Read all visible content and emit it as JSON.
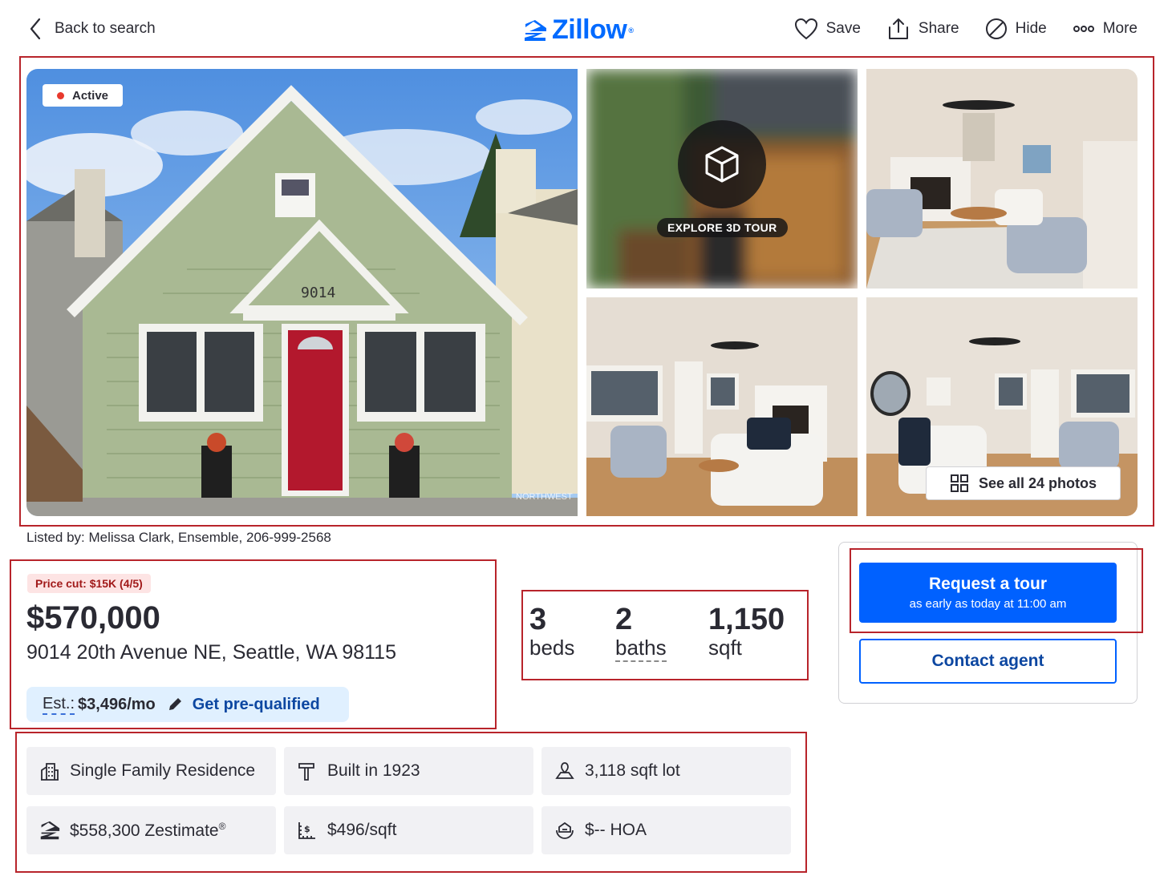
{
  "header": {
    "back_label": "Back to search",
    "logo_text": "Zillow",
    "logo_mark": "®",
    "actions": [
      {
        "label": "Save",
        "icon": "heart-icon"
      },
      {
        "label": "Share",
        "icon": "share-icon"
      },
      {
        "label": "Hide",
        "icon": "hide-icon"
      },
      {
        "label": "More",
        "icon": "more-icon"
      }
    ]
  },
  "gallery": {
    "status_badge": "Active",
    "house_number": "9014",
    "watermark": "NORTHWEST",
    "tour_label": "EXPLORE 3D TOUR",
    "see_all_label": "See all 24 photos"
  },
  "listing": {
    "listed_by": "Listed by: Melissa Clark, Ensemble, 206-999-2568",
    "price_cut": "Price cut: $15K (4/5)",
    "price": "$570,000",
    "address": "9014 20th Avenue NE, Seattle, WA 98115",
    "estimate": {
      "label": "Est.:",
      "value": "$3,496/mo",
      "cta": "Get pre-qualified"
    }
  },
  "facts": [
    {
      "number": "3",
      "label": "beds"
    },
    {
      "number": "2",
      "label": "baths"
    },
    {
      "number": "1,150",
      "label": "sqft"
    }
  ],
  "details": [
    {
      "icon": "building-icon",
      "text": "Single Family Residence"
    },
    {
      "icon": "hammer-icon",
      "text": "Built in 1923"
    },
    {
      "icon": "lot-icon",
      "text": "3,118 sqft lot"
    },
    {
      "icon": "zestimate-icon",
      "text": "$558,300 Zestimate",
      "mark": "®"
    },
    {
      "icon": "price-per-sqft-icon",
      "text": "$496/sqft"
    },
    {
      "icon": "hoa-icon",
      "text": "$-- HOA"
    }
  ],
  "panel": {
    "request_title": "Request a tour",
    "request_sub": "as early as today at 11:00 am",
    "contact_label": "Contact agent"
  },
  "colors": {
    "brand": "#006aff",
    "button": "#0061ff",
    "annotation": "#b8242b",
    "status_dot": "#e8392d"
  }
}
